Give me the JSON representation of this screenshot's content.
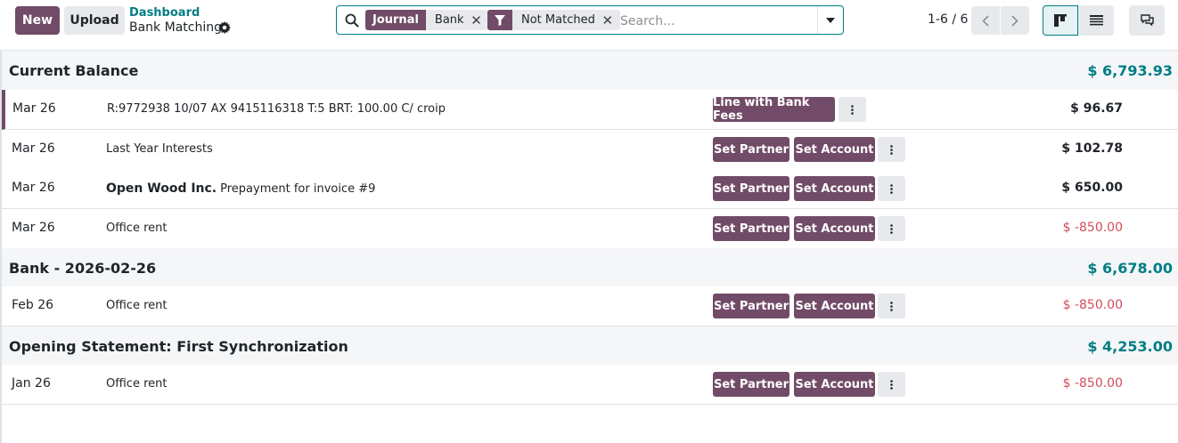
{
  "control_panel": {
    "new_label": "New",
    "upload_label": "Upload",
    "breadcrumb_parent": "Dashboard",
    "breadcrumb_current": "Bank Matching",
    "search": {
      "placeholder": "Search...",
      "facets": [
        {
          "label": "Journal",
          "value": "Bank"
        },
        {
          "icon": "filter-icon",
          "value": "Not Matched"
        }
      ]
    },
    "pager": "1-6 / 6",
    "views": [
      "kanban",
      "list"
    ]
  },
  "groups": [
    {
      "title": "Current Balance",
      "balance": "$ 6,793.93",
      "lines": [
        {
          "date": "Mar 26",
          "partner": "",
          "label": "R:9772938 10/07 AX 9415116318 T:5 BRT: 100.00 C/ croip",
          "amount": "$ 96.67",
          "sign": "pos",
          "action": "Line with Bank Fees"
        },
        {
          "date": "Mar 26",
          "partner": "",
          "label": "Last Year Interests",
          "amount": "$ 102.78",
          "sign": "pos",
          "action": "Set Partner",
          "action2": "Set Account"
        },
        {
          "date": "Mar 26",
          "partner": "Open Wood Inc.",
          "label": "Prepayment for invoice #9",
          "amount": "$ 650.00",
          "sign": "pos",
          "action": "Set Partner",
          "action2": "Set Account"
        },
        {
          "date": "Mar 26",
          "partner": "",
          "label": "Office rent",
          "amount": "$ -850.00",
          "sign": "neg",
          "action": "Set Partner",
          "action2": "Set Account"
        }
      ]
    },
    {
      "title": "Bank - 2026-02-26",
      "balance": "$ 6,678.00",
      "lines": [
        {
          "date": "Feb 26",
          "partner": "",
          "label": "Office rent",
          "amount": "$ -850.00",
          "sign": "neg",
          "action": "Set Partner",
          "action2": "Set Account"
        }
      ]
    },
    {
      "title": "Opening Statement: First Synchronization",
      "balance": "$ 4,253.00",
      "lines": [
        {
          "date": "Jan 26",
          "partner": "",
          "label": "Office rent",
          "amount": "$ -850.00",
          "sign": "neg",
          "action": "Set Partner",
          "action2": "Set Account"
        }
      ]
    }
  ],
  "colors": {
    "brand": "#714b67",
    "accent": "#017e84",
    "negative": "#d44c59"
  }
}
